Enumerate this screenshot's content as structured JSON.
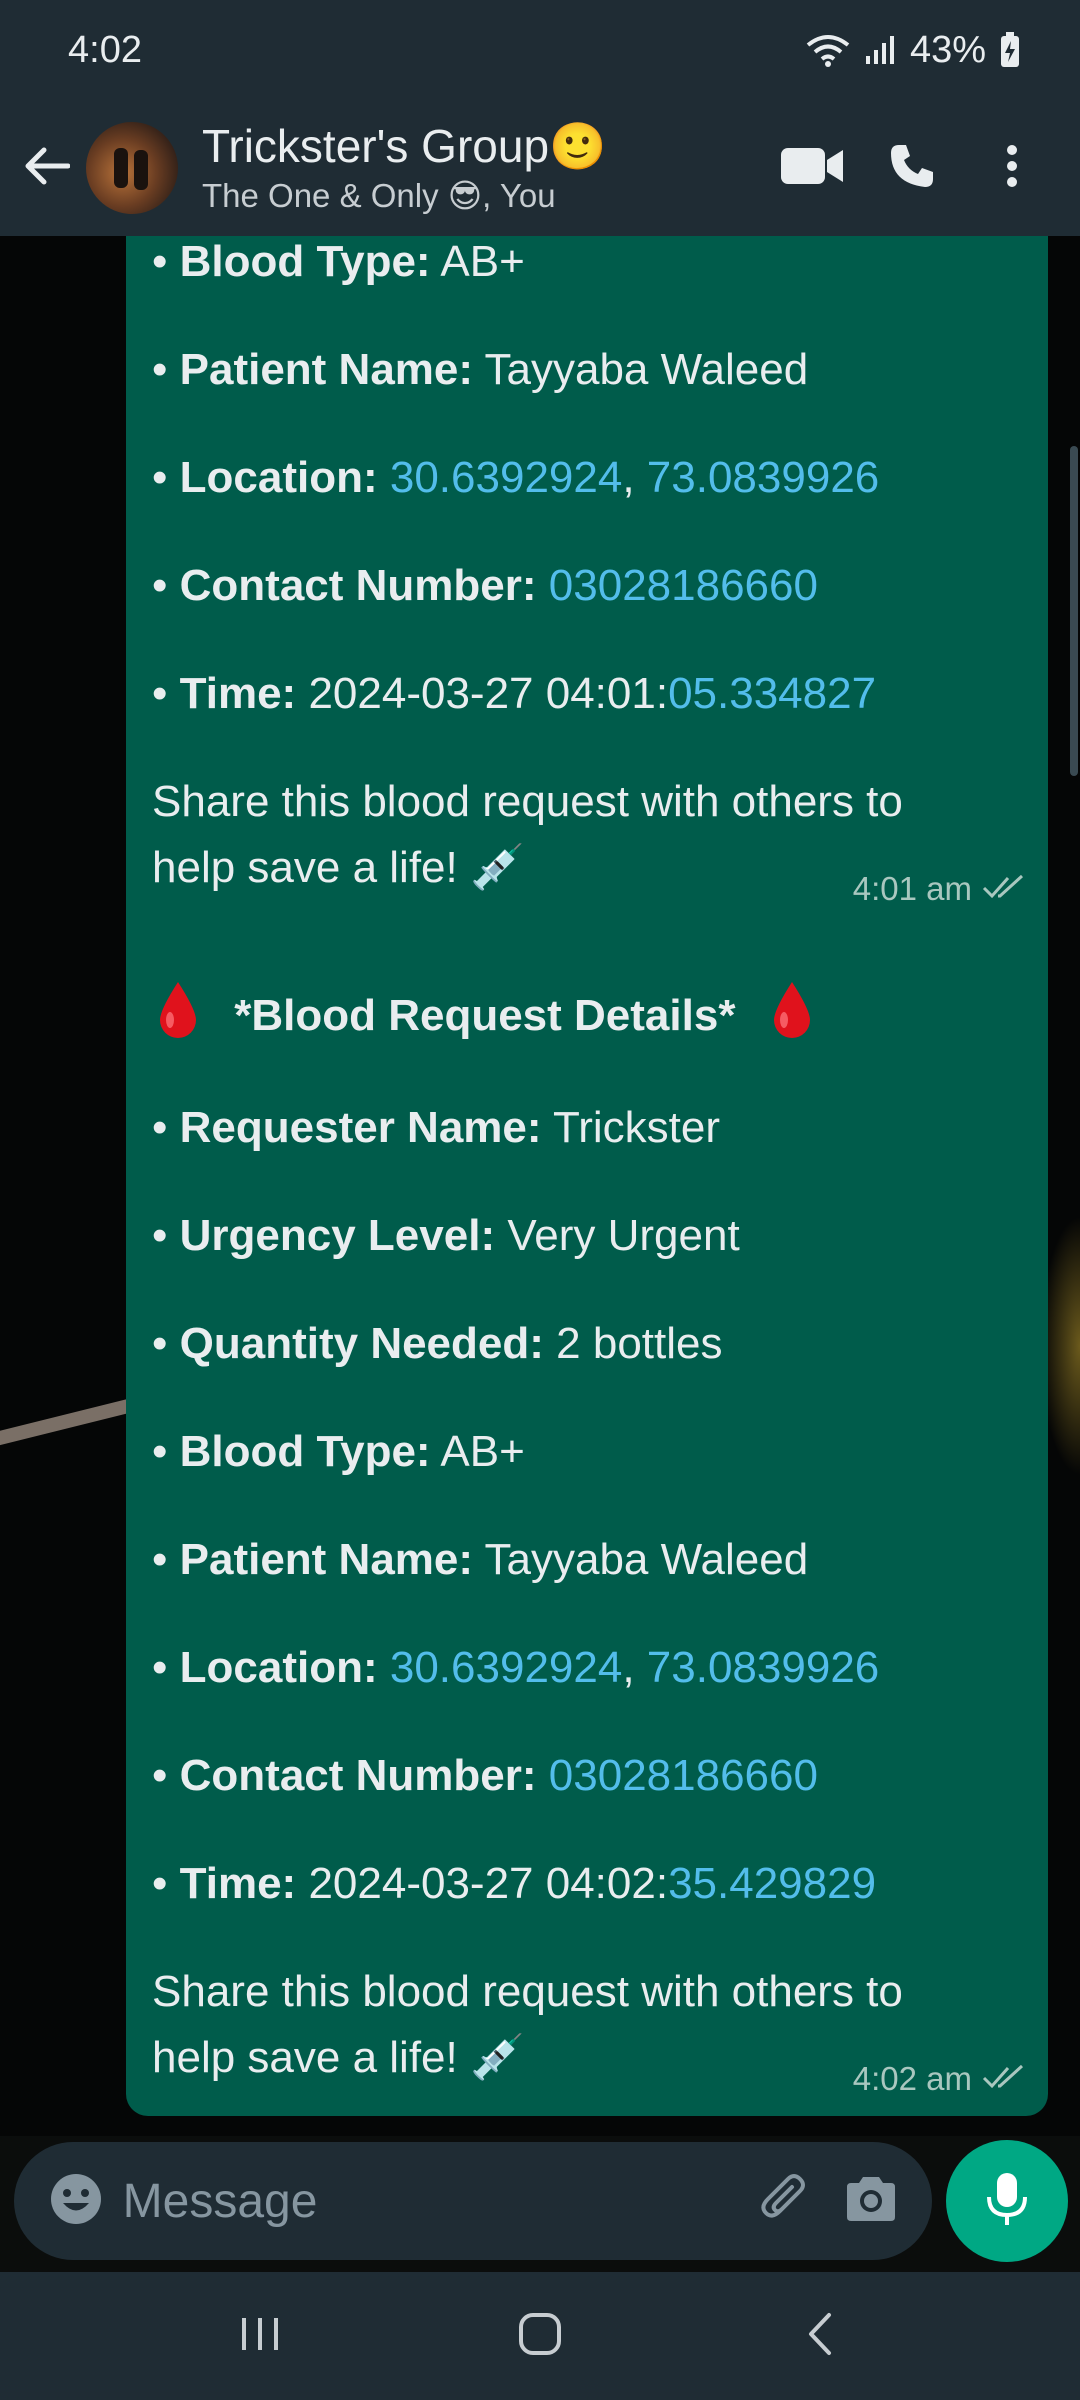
{
  "status_bar": {
    "time": "4:02",
    "battery": "43%"
  },
  "header": {
    "title": "Trickster's Group🙂",
    "subtitle": "The One & Only 😎, You",
    "icons": [
      "back-arrow-icon",
      "video-call-icon",
      "voice-call-icon",
      "more-options-icon"
    ]
  },
  "messages": [
    {
      "lines": {
        "blood_type": {
          "label": "Blood Type:",
          "value": "AB+"
        },
        "patient_name": {
          "label": "Patient Name:",
          "value": "Tayyaba Waleed"
        },
        "location": {
          "label": "Location:",
          "lat": "30.6392924",
          "sep": ",",
          "lng": "73.0839926"
        },
        "contact": {
          "label": "Contact Number:",
          "value": "03028186660"
        },
        "time": {
          "label": "Time:",
          "date": "2024-03-27 04:01:",
          "seconds": "05.334827"
        }
      },
      "share_line1": "Share this blood request with others to",
      "share_line2": "help save a life! 💉",
      "timestamp": "4:01 am"
    },
    {
      "title": "*Blood Request Details*",
      "lines": {
        "requester": {
          "label": "Requester Name:",
          "value": "Trickster"
        },
        "urgency": {
          "label": "Urgency Level:",
          "value": "Very Urgent"
        },
        "quantity": {
          "label": "Quantity Needed:",
          "value": "2 bottles"
        },
        "blood_type": {
          "label": "Blood Type:",
          "value": "AB+"
        },
        "patient_name": {
          "label": "Patient Name:",
          "value": "Tayyaba Waleed"
        },
        "location": {
          "label": "Location:",
          "lat": "30.6392924",
          "sep": ",",
          "lng": "73.0839926"
        },
        "contact": {
          "label": "Contact Number:",
          "value": "03028186660"
        },
        "time": {
          "label": "Time:",
          "date": "2024-03-27 04:02:",
          "seconds": "35.429829"
        }
      },
      "share_line1": "Share this blood request with others to",
      "share_line2": "help save a life! 💉",
      "timestamp": "4:02 am"
    }
  ],
  "input": {
    "placeholder": "Message"
  },
  "colors": {
    "bubble": "#005c4b",
    "link": "#53bdeb",
    "accent": "#00a884",
    "bar": "#1f2c34"
  }
}
